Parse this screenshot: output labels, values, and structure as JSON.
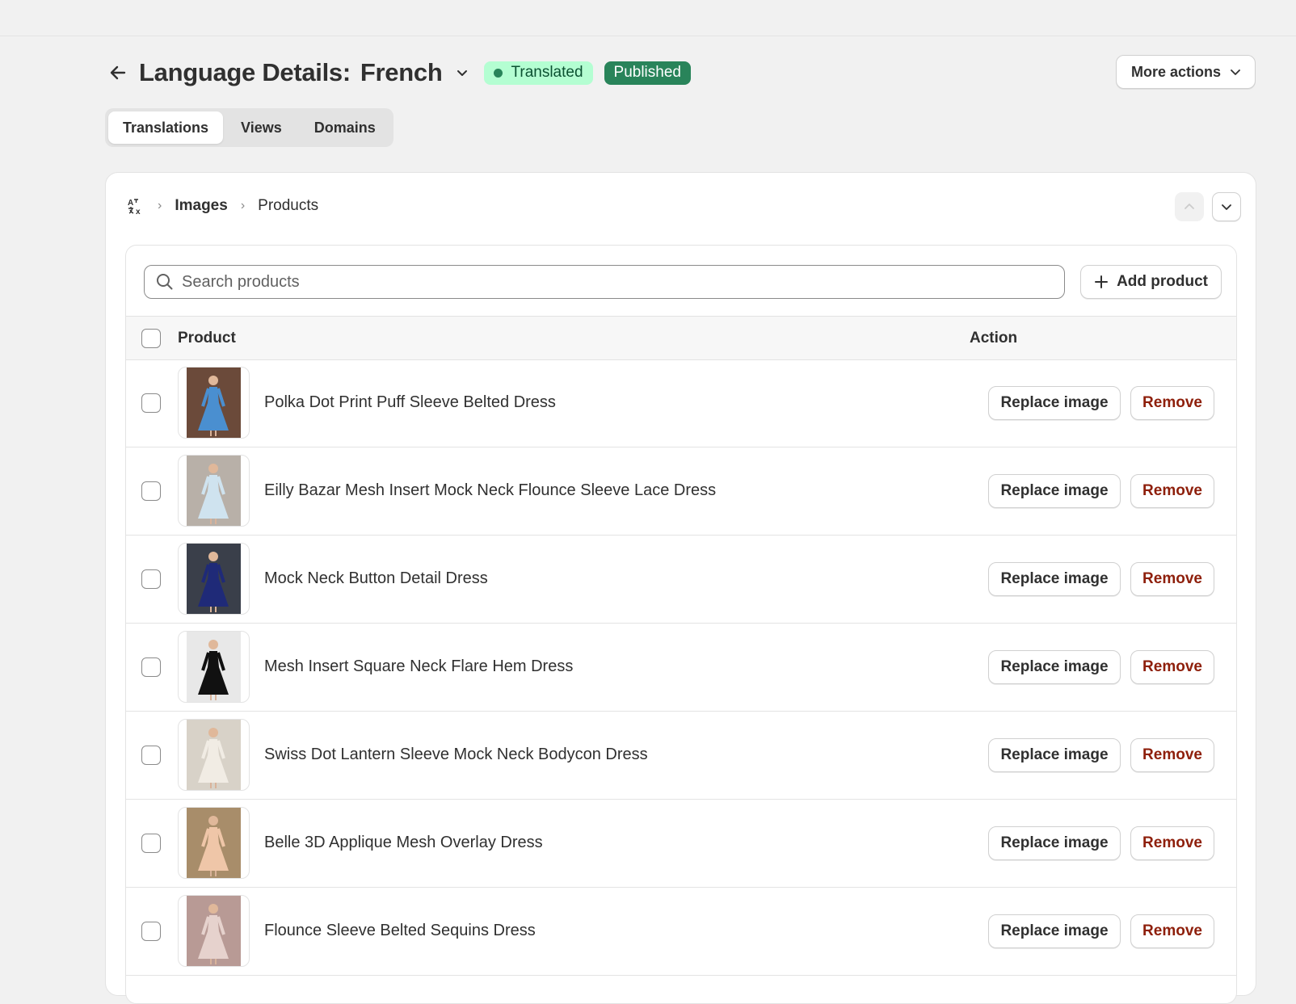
{
  "header": {
    "title_prefix": "Language Details:",
    "title_language": "French",
    "badge_translated": "Translated",
    "badge_published": "Published",
    "more_actions_label": "More actions"
  },
  "tabs": [
    {
      "label": "Translations",
      "active": true
    },
    {
      "label": "Views",
      "active": false
    },
    {
      "label": "Domains",
      "active": false
    }
  ],
  "breadcrumb": {
    "icon": "translate-icon",
    "level1": "Images",
    "level2": "Products"
  },
  "search": {
    "placeholder": "Search products",
    "value": ""
  },
  "add_product_label": "Add product",
  "table": {
    "columns": [
      "Product",
      "Action"
    ],
    "action_replace_label": "Replace image",
    "action_remove_label": "Remove",
    "rows": [
      {
        "name": "Polka Dot Print Puff Sleeve Belted Dress",
        "dress_color": "#4a8fd0",
        "bg": "#6b4a3a"
      },
      {
        "name": "Eilly Bazar Mesh Insert Mock Neck Flounce Sleeve Lace Dress",
        "dress_color": "#cfe3ef",
        "bg": "#b8b0a8"
      },
      {
        "name": "Mock Neck Button Detail Dress",
        "dress_color": "#1f2a78",
        "bg": "#3a3f4a"
      },
      {
        "name": "Mesh Insert Square Neck Flare Hem Dress",
        "dress_color": "#111111",
        "bg": "#e8e8e8"
      },
      {
        "name": "Swiss Dot Lantern Sleeve Mock Neck Bodycon Dress",
        "dress_color": "#f1ece4",
        "bg": "#d8d2c8"
      },
      {
        "name": "Belle 3D Applique Mesh Overlay Dress",
        "dress_color": "#efc6a8",
        "bg": "#a88d6a"
      },
      {
        "name": "Flounce Sleeve Belted Sequins Dress",
        "dress_color": "#e6d2cd",
        "bg": "#b89a95"
      }
    ]
  },
  "colors": {
    "page_bg": "#f1f1f1",
    "translated_bg": "#b4fed2",
    "published_bg": "#29845a",
    "remove_text": "#8e1f0b"
  }
}
